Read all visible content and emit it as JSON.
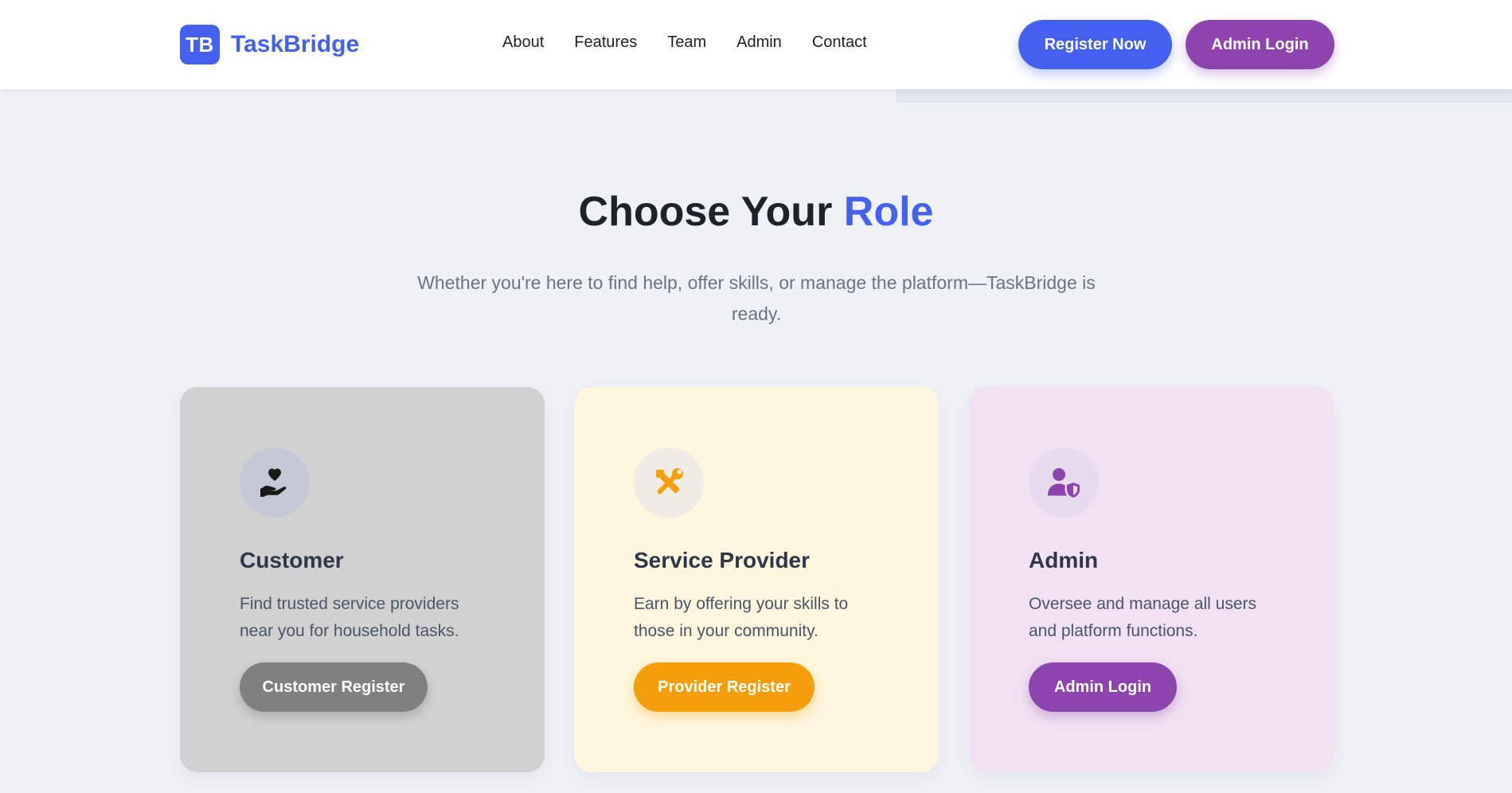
{
  "brand": {
    "logo_text": "TB",
    "name": "TaskBridge"
  },
  "nav": {
    "items": [
      {
        "label": "About"
      },
      {
        "label": "Features"
      },
      {
        "label": "Team"
      },
      {
        "label": "Admin"
      },
      {
        "label": "Contact"
      }
    ]
  },
  "header_actions": {
    "register_label": "Register Now",
    "admin_label": "Admin Login"
  },
  "hero": {
    "title_prefix": "Choose Your",
    "title_accent": "Role",
    "subtitle": "Whether you're here to find help, offer skills, or manage the platform—TaskBridge is ready."
  },
  "cards": [
    {
      "icon": "hand-holding-heart-icon",
      "title": "Customer",
      "description": "Find trusted service providers near you for household tasks.",
      "button": "Customer Register"
    },
    {
      "icon": "tools-icon",
      "title": "Service Provider",
      "description": "Earn by offering your skills to those in your community.",
      "button": "Provider Register"
    },
    {
      "icon": "user-shield-icon",
      "title": "Admin",
      "description": "Oversee and manage all users and platform functions.",
      "button": "Admin Login"
    }
  ],
  "colors": {
    "primary": "#4361ee",
    "admin": "#8e44ad",
    "provider": "#f59e0b",
    "customer_button": "#808080"
  }
}
